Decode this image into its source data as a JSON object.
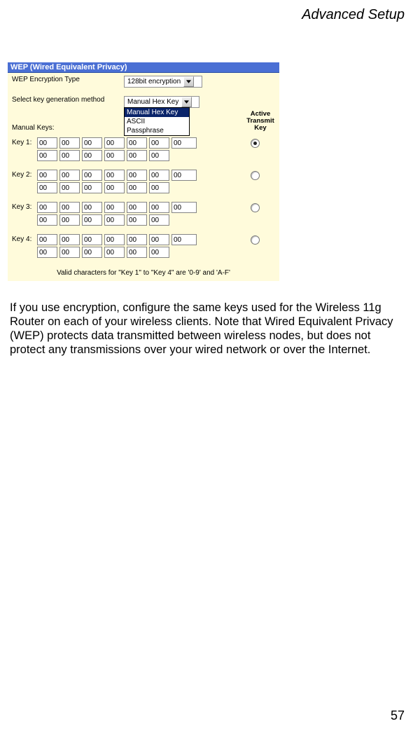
{
  "page_title": "Advanced Setup",
  "page_number": "57",
  "screenshot": {
    "header": "WEP (Wired Equivalent Privacy)",
    "encryption_type_label": "WEP Encryption Type",
    "encryption_type_value": "128bit encryption",
    "keygen_label": "Select key generation method",
    "keygen_value": "Manual Hex Key",
    "keygen_options": [
      "Manual Hex Key",
      "ASCII",
      "Passphrase"
    ],
    "manual_keys_label": "Manual Keys:",
    "active_transmit_key_label": "Active\nTransmit\nKey",
    "keys": [
      {
        "label": "Key 1:",
        "vals": [
          "00",
          "00",
          "00",
          "00",
          "00",
          "00",
          "00",
          "00",
          "00",
          "00",
          "00",
          "00",
          "00"
        ],
        "selected": true
      },
      {
        "label": "Key 2:",
        "vals": [
          "00",
          "00",
          "00",
          "00",
          "00",
          "00",
          "00",
          "00",
          "00",
          "00",
          "00",
          "00",
          "00"
        ],
        "selected": false
      },
      {
        "label": "Key 3:",
        "vals": [
          "00",
          "00",
          "00",
          "00",
          "00",
          "00",
          "00",
          "00",
          "00",
          "00",
          "00",
          "00",
          "00"
        ],
        "selected": false
      },
      {
        "label": "Key 4:",
        "vals": [
          "00",
          "00",
          "00",
          "00",
          "00",
          "00",
          "00",
          "00",
          "00",
          "00",
          "00",
          "00",
          "00"
        ],
        "selected": false
      }
    ],
    "valid_note": "Valid characters for \"Key 1\" to \"Key 4\" are '0-9' and 'A-F'"
  },
  "body_text": "If you use encryption, configure the same keys used for the Wireless 11g Router on each of your wireless clients. Note that Wired Equivalent Privacy (WEP) protects data transmitted between wireless nodes, but does not protect any transmissions over your wired network or over the Internet."
}
